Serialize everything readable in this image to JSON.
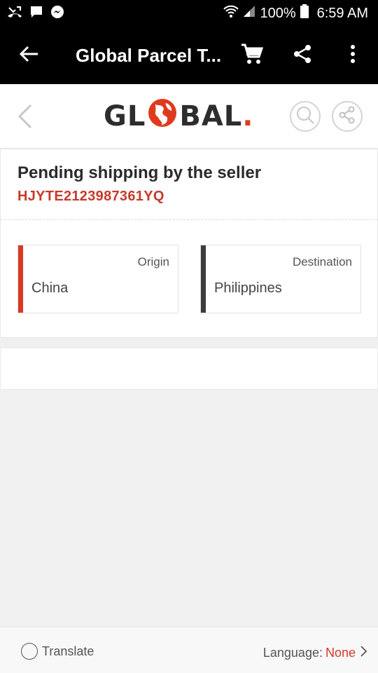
{
  "status_bar": {
    "battery": "100%",
    "time": "6:59 AM"
  },
  "app_bar": {
    "title": "Global Parcel T...",
    "icons": [
      "back-arrow-icon",
      "cart-icon",
      "share-icon",
      "more-vert-icon"
    ]
  },
  "header": {
    "logo_text": {
      "left": "GL",
      "right": "BAL",
      "dot": "."
    },
    "icons": [
      "chevron-left-icon",
      "search-icon",
      "share-icon"
    ]
  },
  "shipment": {
    "status": "Pending shipping by the seller",
    "tracking_number": "HJYTE2123987361YQ",
    "origin": {
      "label": "Origin",
      "value": "China",
      "accent": "#d63a20"
    },
    "destination": {
      "label": "Destination",
      "value": "Philippines",
      "accent": "#3c3c3c"
    }
  },
  "footer": {
    "translate_label": "Translate",
    "language_label": "Language:",
    "language_value": "None"
  },
  "colors": {
    "brand_red": "#e03a1e",
    "tracking_red": "#c8392b",
    "page_bg": "#f0f0f0"
  }
}
